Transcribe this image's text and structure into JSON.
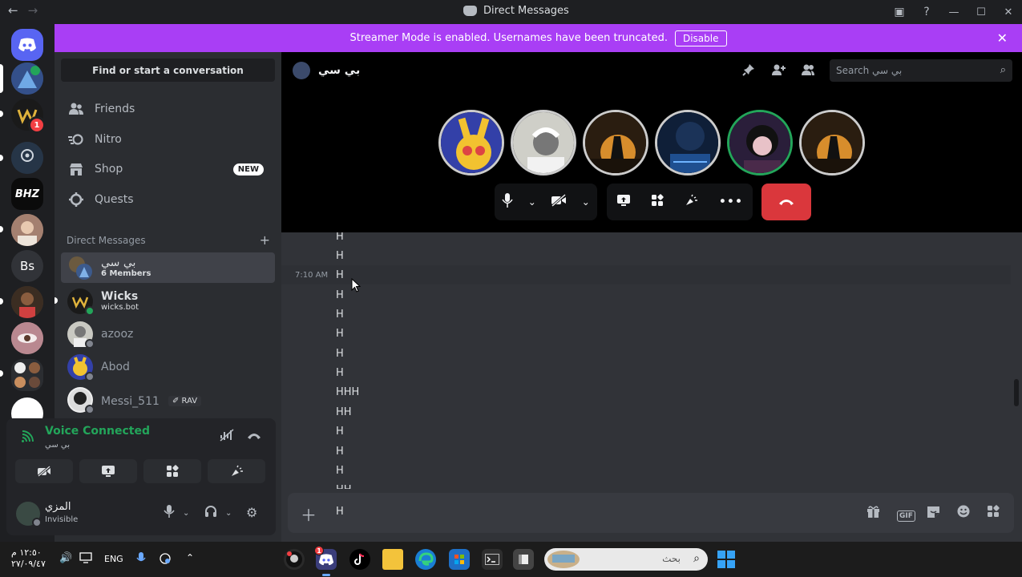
{
  "window": {
    "title": "Direct Messages",
    "controls": {
      "minimize": "—",
      "maximize": "☐",
      "close": "✕"
    }
  },
  "banner": {
    "text": "Streamer Mode is enabled. Usernames have been truncated.",
    "button": "Disable",
    "close": "✕"
  },
  "servers": [
    {
      "label": "",
      "icon": "discord-icon"
    },
    {
      "label": "",
      "icon": "server-avatar"
    },
    {
      "label": "",
      "badge": "1",
      "icon": "server-avatar"
    },
    {
      "label": "",
      "icon": "steam-server-avatar"
    },
    {
      "label": "BHZ",
      "icon": "server-avatar"
    },
    {
      "label": "",
      "icon": "server-avatar"
    },
    {
      "label": "Bs",
      "icon": "server-initials"
    },
    {
      "label": "",
      "icon": "server-avatar"
    },
    {
      "label": "",
      "icon": "server-avatar"
    },
    {
      "label": "",
      "icon": "server-folder"
    }
  ],
  "sidebar": {
    "search_label": "Find or start a conversation",
    "nav": [
      {
        "label": "Friends",
        "icon": "friends-icon"
      },
      {
        "label": "Nitro",
        "icon": "nitro-icon"
      },
      {
        "label": "Shop",
        "icon": "shop-icon",
        "badge": "NEW"
      },
      {
        "label": "Quests",
        "icon": "quests-icon"
      }
    ],
    "dm_header": "Direct Messages",
    "dm_add": "+",
    "dms": [
      {
        "name": "بي سي",
        "sub": "6 Members",
        "active": true
      },
      {
        "name": "Wicks",
        "sub": "wicks.bot"
      },
      {
        "name": "azooz",
        "sub": ""
      },
      {
        "name": "Abod",
        "sub": ""
      },
      {
        "name": "Messi_511",
        "sub": "",
        "tag": "✐ RAV"
      }
    ]
  },
  "voice": {
    "status": "Voice Connected",
    "channel": "بي سي"
  },
  "user": {
    "name": "المزي",
    "status": "Invisible"
  },
  "channel": {
    "name": "بي سي",
    "search_placeholder": "Search بي سي"
  },
  "messages": {
    "timestamp": "7:10 AM",
    "lines": [
      "H",
      "H",
      "H",
      "H",
      "H",
      "H",
      "H",
      "H",
      "HHH",
      "HH",
      "H",
      "H",
      "H",
      "HH"
    ]
  },
  "composer": {
    "value": "H",
    "gif_label": "GIF"
  },
  "taskbar": {
    "time": "١٢:٥٠ م",
    "date": "٢٧/٠٩/٤٧",
    "lang": "ENG",
    "search_placeholder": "بحث",
    "discord_badge": "1"
  },
  "colors": {
    "accent": "#5865f2",
    "banner": "#a93ef5",
    "online": "#23a55a",
    "danger": "#da373c"
  }
}
